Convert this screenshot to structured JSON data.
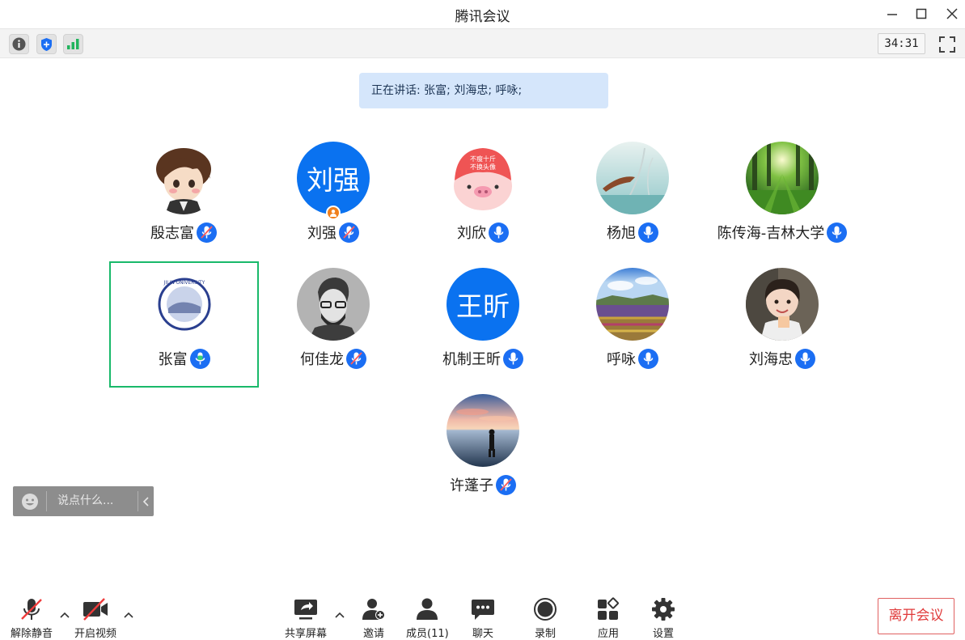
{
  "window": {
    "title": "腾讯会议"
  },
  "infobar": {
    "timer": "34:31"
  },
  "speaking": {
    "text": "正在讲话: 张富; 刘海忠; 呼咏;"
  },
  "participants": [
    {
      "name": "殷志富",
      "avatar_text": "",
      "mic": "muted"
    },
    {
      "name": "刘强",
      "avatar_text": "刘强",
      "mic": "muted",
      "host": true
    },
    {
      "name": "刘欣",
      "avatar_text": "",
      "mic": "on"
    },
    {
      "name": "杨旭",
      "avatar_text": "",
      "mic": "on"
    },
    {
      "name": "陈传海-吉林大学",
      "avatar_text": "",
      "mic": "on"
    },
    {
      "name": "张富",
      "avatar_text": "",
      "mic": "speaking",
      "active": true
    },
    {
      "name": "何佳龙",
      "avatar_text": "",
      "mic": "muted"
    },
    {
      "name": "机制王昕",
      "avatar_text": "王昕",
      "mic": "on"
    },
    {
      "name": "呼咏",
      "avatar_text": "",
      "mic": "on"
    },
    {
      "name": "刘海忠",
      "avatar_text": "",
      "mic": "on"
    },
    {
      "name": "许蓬子",
      "avatar_text": "",
      "mic": "muted"
    }
  ],
  "chat": {
    "placeholder": "说点什么..."
  },
  "toolbar": {
    "unmute": "解除静音",
    "video": "开启视频",
    "share": "共享屏幕",
    "invite": "邀请",
    "members": "成员(11)",
    "chat": "聊天",
    "record": "录制",
    "apps": "应用",
    "settings": "设置",
    "leave": "离开会议"
  },
  "colors": {
    "accent": "#1b6ef3",
    "active_border": "#19b96a",
    "leave": "#e03a3a",
    "host": "#f07f1c"
  }
}
